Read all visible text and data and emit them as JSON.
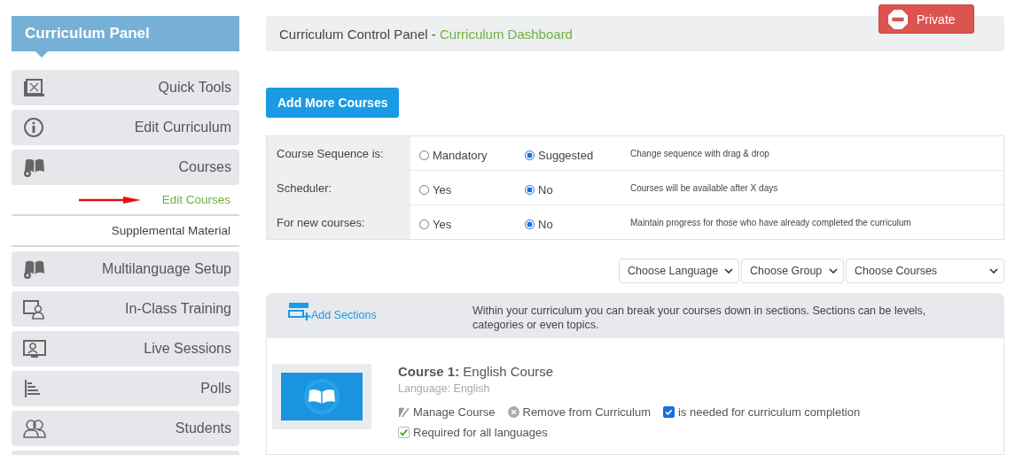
{
  "sidebar": {
    "title": "Curriculum Panel",
    "items": [
      {
        "kind": "item",
        "label": "Quick Tools"
      },
      {
        "kind": "item",
        "label": "Edit Curriculum"
      },
      {
        "kind": "item",
        "label": "Courses"
      },
      {
        "kind": "subitem",
        "label": "Edit Courses",
        "selected": true
      },
      {
        "kind": "subitem",
        "label": "Supplemental Material",
        "selected": false
      },
      {
        "kind": "item",
        "label": "Multilanguage Setup"
      },
      {
        "kind": "item",
        "label": "In-Class Training"
      },
      {
        "kind": "item",
        "label": "Live Sessions"
      },
      {
        "kind": "item",
        "label": "Polls"
      },
      {
        "kind": "item",
        "label": "Students"
      }
    ]
  },
  "header": {
    "title": "Curriculum Control Panel - ",
    "link": "Curriculum Dashboard",
    "badge": "Private"
  },
  "add_button": "Add More Courses",
  "settings": [
    {
      "label": "Course Sequence is:",
      "options": [
        {
          "label": "Mandatory",
          "selected": false
        },
        {
          "label": "Suggested",
          "selected": true
        }
      ],
      "note": "Change sequence with drag & drop"
    },
    {
      "label": "Scheduler:",
      "options": [
        {
          "label": "Yes",
          "selected": false
        },
        {
          "label": "No",
          "selected": true
        }
      ],
      "note": "Courses will be available after X days"
    },
    {
      "label": "For new courses:",
      "options": [
        {
          "label": "Yes",
          "selected": false
        },
        {
          "label": "No",
          "selected": true
        }
      ],
      "note": "Maintain progress for those who have already completed the curriculum"
    }
  ],
  "filters": [
    "Choose Language",
    "Choose Group",
    "Choose Courses"
  ],
  "sections": {
    "button": "Add Sections",
    "info": "Within your curriculum you can break your courses down in sections. Sections can be levels, categories or even topics."
  },
  "course": {
    "title": "**Course 1:** English Course",
    "language": "Language: English",
    "manage": "Manage Course",
    "remove": "Remove from Curriculum",
    "needed": {
      "label": "is needed for curriculum completion",
      "checked": true
    },
    "required": {
      "label": "Required for all languages",
      "checked": true
    }
  }
}
